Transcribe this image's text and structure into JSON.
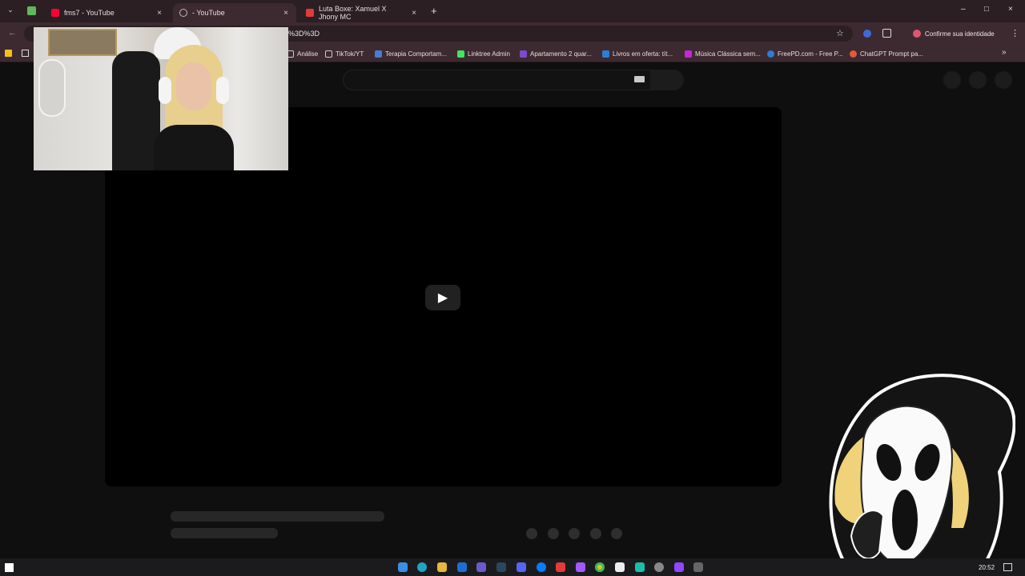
{
  "browser": {
    "tabs": [
      {
        "label": "fms7 - YouTube",
        "close": "×"
      },
      {
        "label": "- YouTube",
        "close": "×"
      },
      {
        "label": "Luta Boxe: Xamuel X Jhony MC",
        "close": "×"
      }
    ],
    "new_tab": "+",
    "window_controls": {
      "minimize": "–",
      "maximize": "□",
      "close": "×"
    },
    "nav": {
      "back": "←",
      "forward": "→"
    },
    "address": "%3D%3D",
    "identity_button": "Confirme sua identidade",
    "menu": "⋮",
    "bookmarks": [
      {
        "label": "Análise",
        "color": "#8a8a8a"
      },
      {
        "label": "TikTok/YT",
        "color": "#8a8a8a"
      },
      {
        "label": "Terapia Comportam...",
        "color": "#4a7bd1"
      },
      {
        "label": "Linktree Admin",
        "color": "#43e55e"
      },
      {
        "label": "Apartamento 2 quar...",
        "color": "#7b4ad1"
      },
      {
        "label": "Livros em oferta: tít...",
        "color": "#2d7dd2"
      },
      {
        "label": "Música Clássica sem...",
        "color": "#c428d6"
      },
      {
        "label": "FreePD.com - Free P...",
        "color": "#2d7dd2"
      },
      {
        "label": "ChatGPT Prompt pa...",
        "color": "#e35a3a"
      }
    ],
    "bookmarks_more": "»"
  },
  "youtube": {
    "play_icon": "▶"
  },
  "taskbar": {
    "time": "20:52"
  },
  "colors": {
    "titlebar": "#2b1f24",
    "toolbar": "#3d2a31",
    "page_bg": "#0f0f0f",
    "player_bg": "#000000"
  }
}
